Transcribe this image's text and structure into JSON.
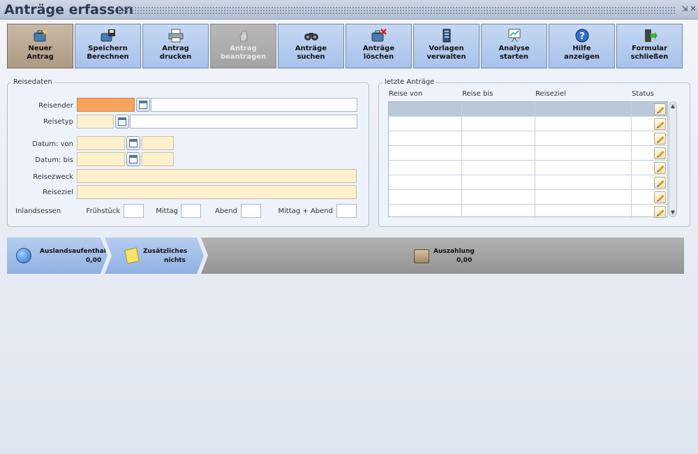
{
  "window": {
    "title": "Anträge erfassen",
    "minimize_glyph": "⇲",
    "close_glyph": "✕"
  },
  "toolbar": [
    {
      "label": "Neuer\nAntrag",
      "icon": "new-request-icon",
      "state": "active"
    },
    {
      "label": "Speichern\nBerechnen",
      "icon": "save-icon",
      "state": "normal"
    },
    {
      "label": "Antrag\ndrucken",
      "icon": "printer-icon",
      "state": "normal"
    },
    {
      "label": "Antrag\nbeantragen",
      "icon": "hand-icon",
      "state": "disabled"
    },
    {
      "label": "Anträge\nsuchen",
      "icon": "binoculars-icon",
      "state": "normal"
    },
    {
      "label": "Anträge\nlöschen",
      "icon": "delete-request-icon",
      "state": "normal"
    },
    {
      "label": "Vorlagen\nverwalten",
      "icon": "templates-icon",
      "state": "normal"
    },
    {
      "label": "Analyse\nstarten",
      "icon": "analysis-icon",
      "state": "normal"
    },
    {
      "label": "Hilfe\nanzeigen",
      "icon": "help-icon",
      "state": "normal"
    },
    {
      "label": "Formular\nschließen",
      "icon": "exit-icon",
      "state": "normal"
    }
  ],
  "reisedaten": {
    "title": "Reisedaten",
    "labels": {
      "reisender": "Reisender",
      "reisetyp": "Reisetyp",
      "datum_von": "Datum: von",
      "datum_bis": "Datum: bis",
      "reisezweck": "Reisezweck",
      "reiseziel": "Reiseziel",
      "inlandsessen": "Inlandsessen",
      "fruehstueck": "Frühstück",
      "mittag": "Mittag",
      "abend": "Abend",
      "mittag_abend": "Mittag + Abend"
    }
  },
  "letzte_antraege": {
    "title": "letzte Anträge",
    "columns": [
      "Reise von",
      "Reise bis",
      "Reiseziel",
      "Status"
    ],
    "row_count": 8
  },
  "steps": [
    {
      "label": "Auslandsaufenthalt",
      "value": "0,00",
      "icon": "globe-icon"
    },
    {
      "label": "Zusätzliches",
      "value": "nichts",
      "icon": "note-icon"
    },
    {
      "label": "Auszahlung",
      "value": "0,00",
      "icon": "payout-icon"
    }
  ],
  "colors": {
    "accent": "#a7c2ea",
    "active": "#ad9a83",
    "highlight_field": "#f7a35c",
    "required_field": "#fdf0cc"
  }
}
